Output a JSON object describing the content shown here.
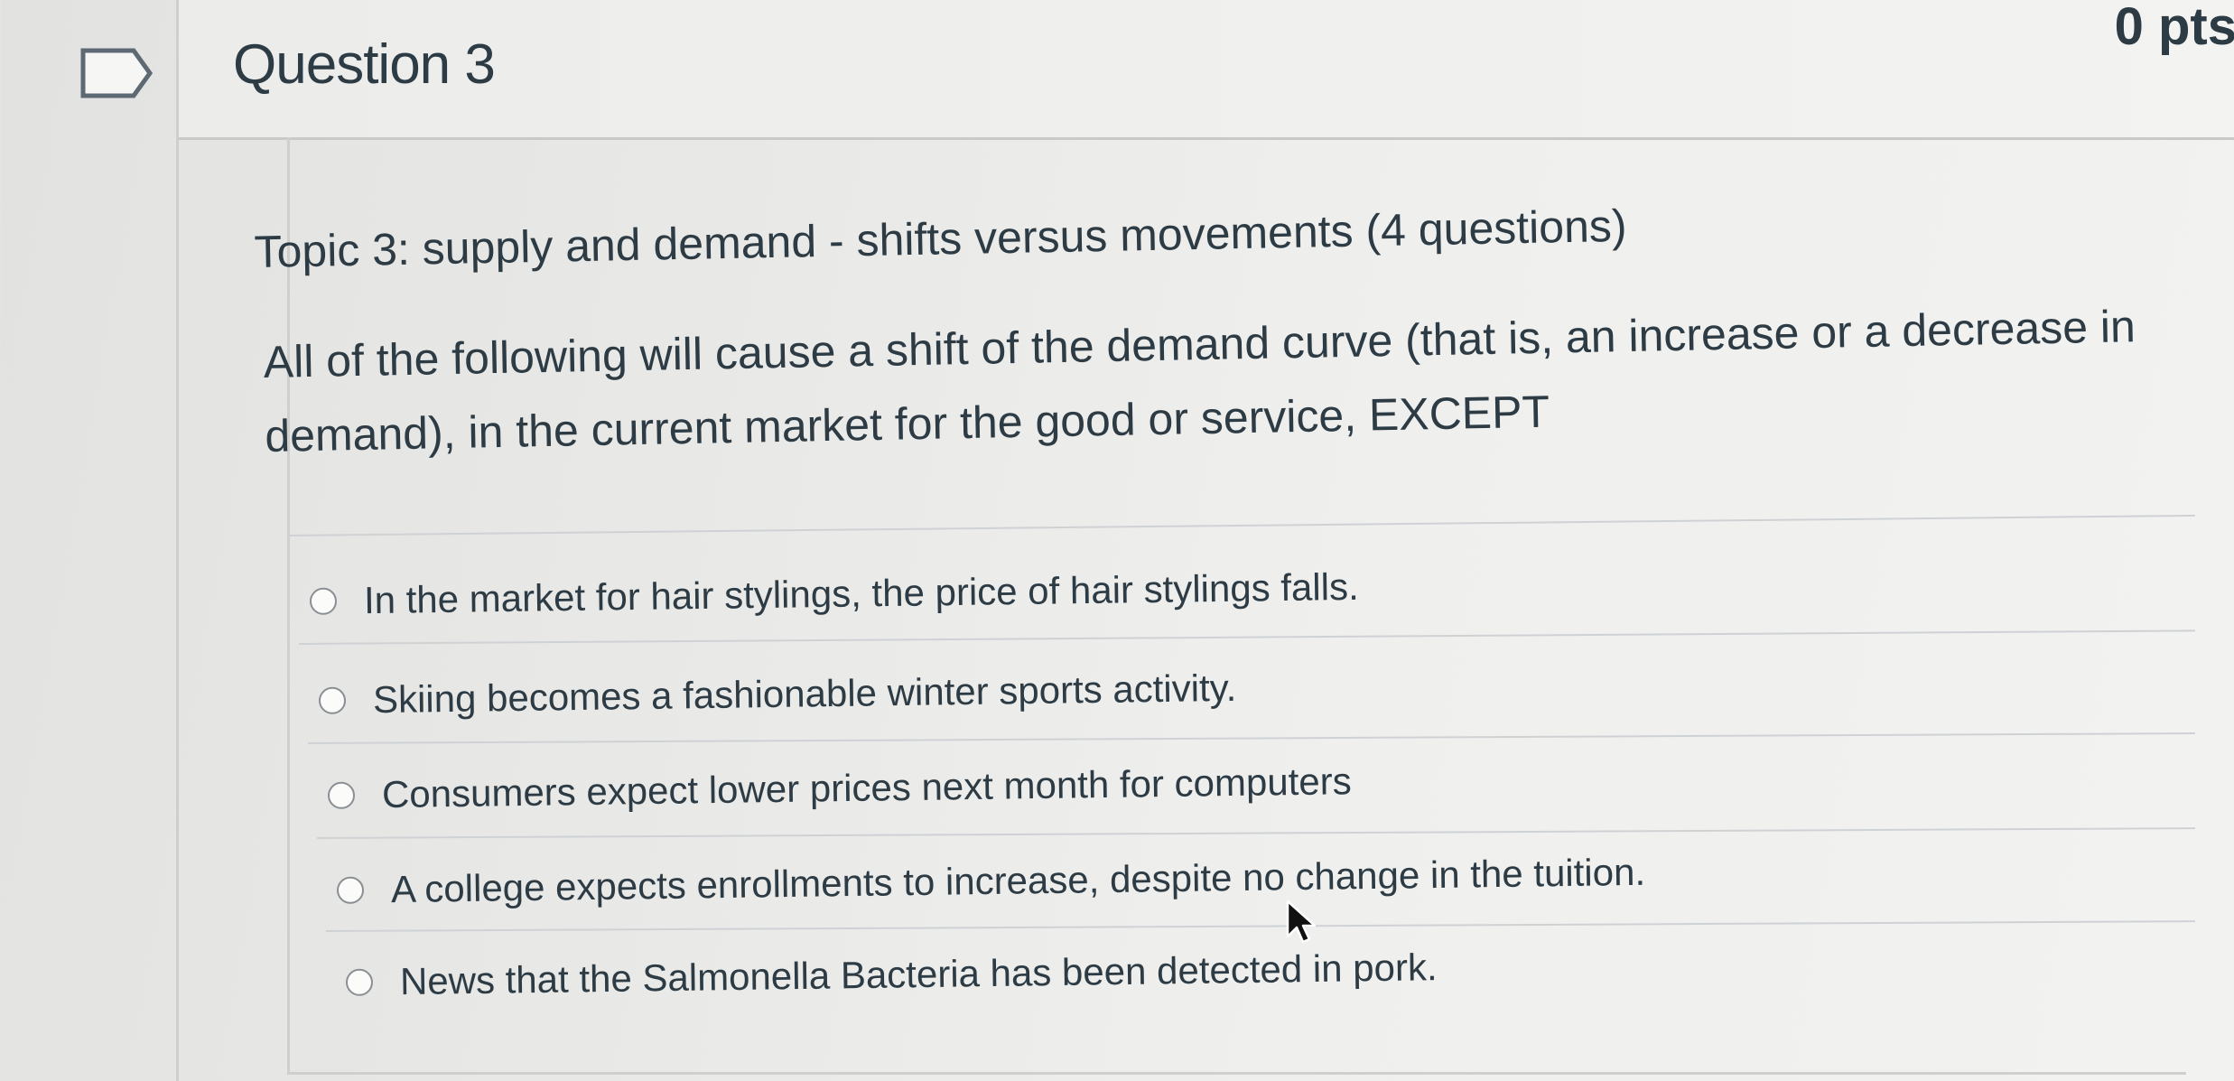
{
  "question": {
    "title": "Question 3",
    "points": "0 pts",
    "topic": "Topic 3: supply and demand - shifts versus movements (4 questions)",
    "prompt": "All of the following will cause a shift of the demand curve (that is, an increase or a decrease in demand), in the current market for the good or service, EXCEPT",
    "answers": [
      {
        "label": "In the market for hair stylings, the price of hair stylings falls."
      },
      {
        "label": "Skiing becomes a fashionable winter sports activity."
      },
      {
        "label": "Consumers expect lower prices next month for computers"
      },
      {
        "label": "A college expects enrollments to increase, despite no change in the tuition."
      },
      {
        "label": "News that the Salmonella Bacteria has been detected in pork."
      }
    ]
  },
  "icons": {
    "flag": "flag-icon",
    "cursor": "mouse-pointer-icon",
    "radio": "radio-button-icon"
  },
  "colors": {
    "text": "#2d3b45",
    "border": "#cfcfcd",
    "background": "#ececea"
  }
}
